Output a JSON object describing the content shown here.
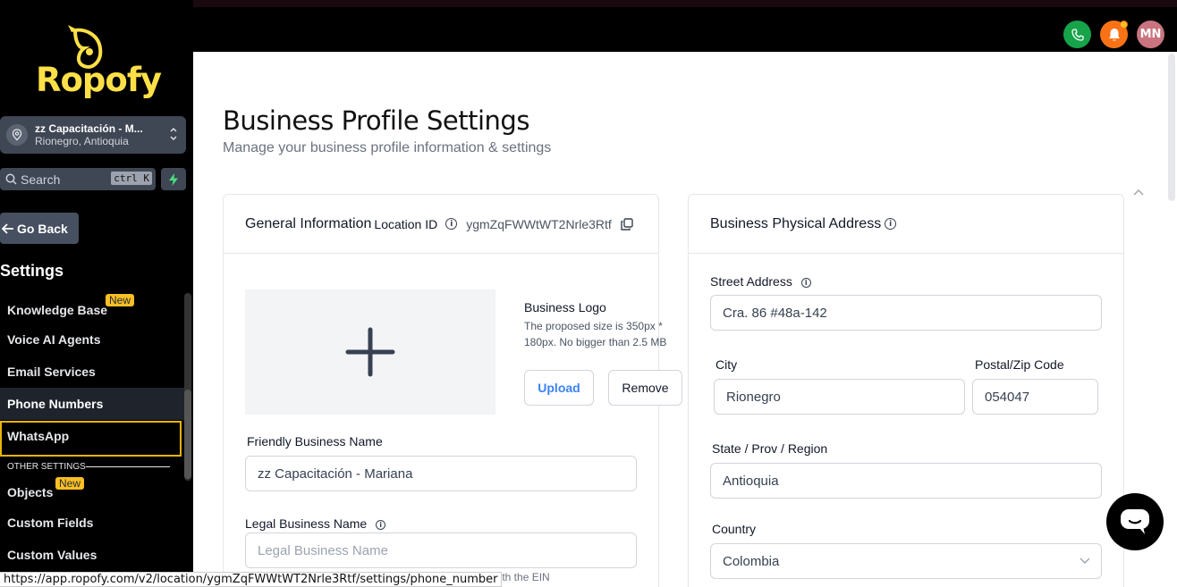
{
  "brand": {
    "name": "Ropofy",
    "accent": "#fde047"
  },
  "topbar": {
    "avatar_initials": "MN",
    "phone_color": "#16a34a",
    "bell_color": "#f97316",
    "avatar_color": "#c9747f"
  },
  "location_switcher": {
    "name": "zz Capacitación - M...",
    "subtitle": "Rionegro, Antioquia"
  },
  "search": {
    "placeholder": "Search",
    "shortcut": "ctrl K"
  },
  "go_back_label": "Go Back",
  "sidebar": {
    "section_title": "Settings",
    "items": [
      {
        "label": "Knowledge Base",
        "badge": "New"
      },
      {
        "label": "Voice AI Agents"
      },
      {
        "label": "Email Services"
      },
      {
        "label": "Phone Numbers",
        "state": "active"
      },
      {
        "label": "WhatsApp",
        "state": "focused"
      }
    ],
    "other_settings_label": "OTHER SETTINGS",
    "other_items": [
      {
        "label": "Objects",
        "badge": "New"
      },
      {
        "label": "Custom Fields"
      },
      {
        "label": "Custom Values"
      }
    ]
  },
  "page": {
    "title": "Business Profile Settings",
    "subtitle": "Manage your business profile information & settings"
  },
  "general_info": {
    "title": "General Information",
    "location_id_label": "Location ID",
    "location_id_value": "ygmZqFWWtWT2Nrle3Rtf",
    "logo_title": "Business Logo",
    "logo_hint_1": "The proposed size is 350px *",
    "logo_hint_2": "180px. No bigger than 2.5 MB",
    "upload_label": "Upload",
    "remove_label": "Remove",
    "friendly_name_label": "Friendly Business Name",
    "friendly_name_value": "zz Capacitación - Mariana",
    "legal_name_label": "Legal Business Name",
    "legal_name_placeholder": "Legal Business Name",
    "legal_hint_partial": "d with the EIN"
  },
  "address": {
    "title": "Business Physical Address",
    "street_label": "Street Address",
    "street_value": "Cra. 86 #48a-142",
    "city_label": "City",
    "city_value": "Rionegro",
    "zip_label": "Postal/Zip Code",
    "zip_value": "054047",
    "state_label": "State / Prov / Region",
    "state_value": "Antioquia",
    "country_label": "Country",
    "country_value": "Colombia"
  },
  "status_url": "https://app.ropofy.com/v2/location/ygmZqFWWtWT2Nrle3Rtf/settings/phone_number"
}
